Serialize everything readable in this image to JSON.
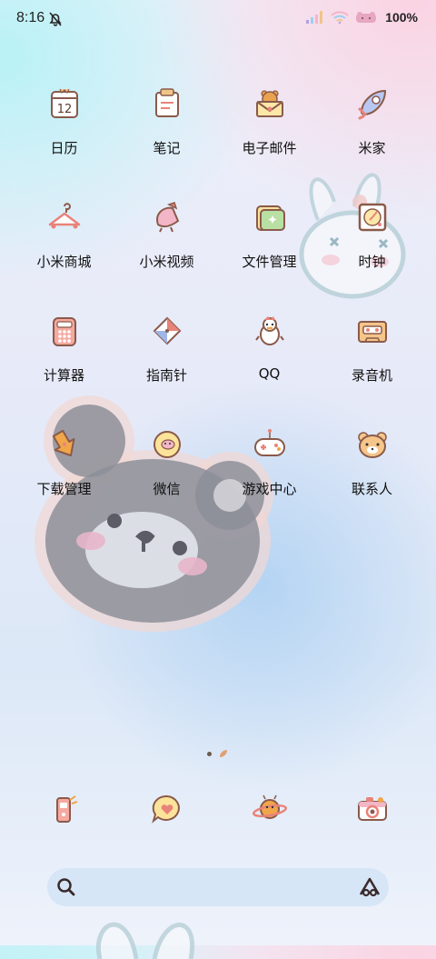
{
  "status_bar": {
    "time": "8:16",
    "battery": "100%"
  },
  "apps": [
    {
      "label": "日历",
      "icon": "calendar-icon",
      "icon_text": "12"
    },
    {
      "label": "笔记",
      "icon": "notes-icon"
    },
    {
      "label": "电子邮件",
      "icon": "email-icon"
    },
    {
      "label": "米家",
      "icon": "mi-home-icon"
    },
    {
      "label": "小米商城",
      "icon": "mi-store-icon"
    },
    {
      "label": "小米视频",
      "icon": "mi-video-icon"
    },
    {
      "label": "文件管理",
      "icon": "file-manager-icon"
    },
    {
      "label": "时钟",
      "icon": "clock-icon"
    },
    {
      "label": "计算器",
      "icon": "calculator-icon"
    },
    {
      "label": "指南针",
      "icon": "compass-icon"
    },
    {
      "label": "QQ",
      "icon": "qq-icon"
    },
    {
      "label": "录音机",
      "icon": "recorder-icon"
    },
    {
      "label": "下载管理",
      "icon": "download-icon"
    },
    {
      "label": "微信",
      "icon": "wechat-icon"
    },
    {
      "label": "游戏中心",
      "icon": "game-center-icon"
    },
    {
      "label": "联系人",
      "icon": "contacts-icon"
    }
  ],
  "page_indicator": {
    "pages": 2,
    "current": 1
  },
  "dock": [
    {
      "icon": "phone-icon"
    },
    {
      "icon": "messages-icon"
    },
    {
      "icon": "browser-icon"
    },
    {
      "icon": "camera-icon"
    }
  ],
  "colors": {
    "accent": "#e8837a",
    "outline": "#8a5a4a",
    "search_bg": "#d2e4f6"
  }
}
